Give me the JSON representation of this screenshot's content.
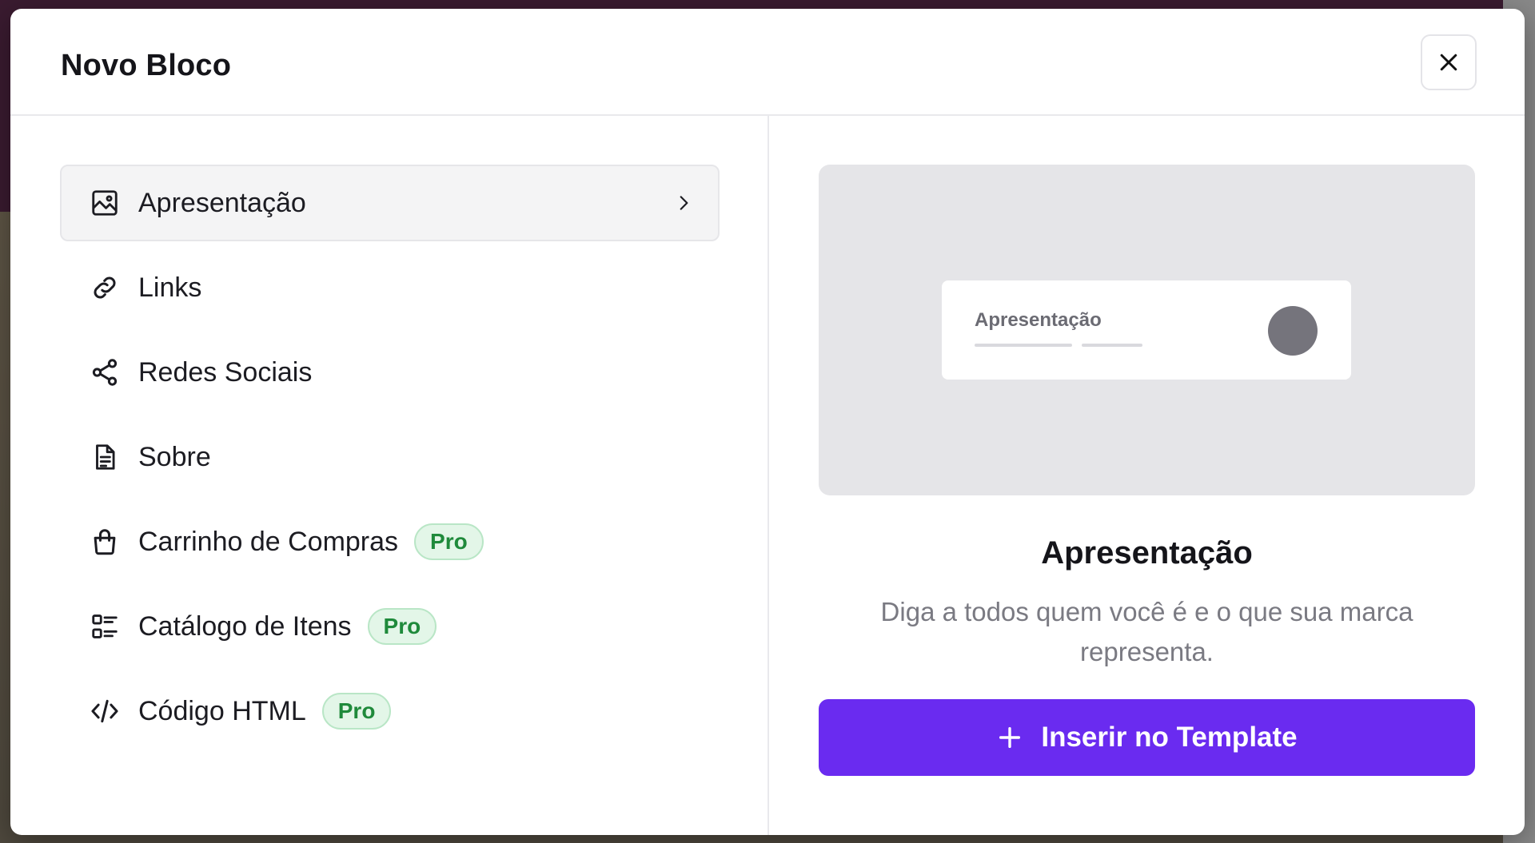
{
  "modal": {
    "title": "Novo Bloco"
  },
  "menu": {
    "items": [
      {
        "label": "Apresentação",
        "icon": "image-icon",
        "pro": false,
        "selected": true
      },
      {
        "label": "Links",
        "icon": "link-icon",
        "pro": false,
        "selected": false
      },
      {
        "label": "Redes Sociais",
        "icon": "share-icon",
        "pro": false,
        "selected": false
      },
      {
        "label": "Sobre",
        "icon": "document-icon",
        "pro": false,
        "selected": false
      },
      {
        "label": "Carrinho de Compras",
        "icon": "shopping-bag-icon",
        "pro": true,
        "selected": false
      },
      {
        "label": "Catálogo de Itens",
        "icon": "catalog-list-icon",
        "pro": true,
        "selected": false
      },
      {
        "label": "Código HTML",
        "icon": "code-icon",
        "pro": true,
        "selected": false
      }
    ],
    "pro_label": "Pro"
  },
  "preview": {
    "card_title": "Apresentação"
  },
  "detail": {
    "title": "Apresentação",
    "description": "Diga a todos quem você é e o que sua marca representa."
  },
  "insert_button": {
    "label": "Inserir no Template"
  },
  "colors": {
    "accent": "#6a2bf0",
    "pro_badge_text": "#1f8a3b",
    "pro_badge_bg": "#e3f6e8"
  }
}
